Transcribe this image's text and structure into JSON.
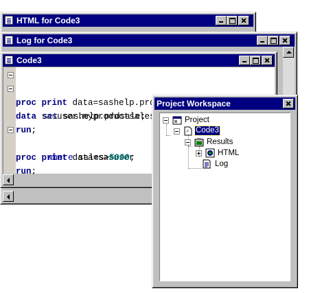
{
  "windows": {
    "html": {
      "title": "HTML for Code3"
    },
    "log": {
      "title": "Log for Code3"
    },
    "code": {
      "title": "Code3",
      "lines": [
        {
          "kw": "proc print",
          "rest": " data=sashelp.prdsale;"
        },
        {
          "kw": "data",
          "rest": " sasuser.myproductsales;"
        },
        {
          "kw2": "set",
          "rest": " sashelp.prdsale;"
        },
        {
          "kw": "run",
          "rest": ";"
        },
        {
          "kw": "proc print",
          "rest": " data=sasuser"
        },
        {
          "kw2": "where",
          "rest": " sales>",
          "num": "5000",
          "tail": ";"
        },
        {
          "kw": "run",
          "rest": ";"
        }
      ]
    },
    "workspace": {
      "title": "Project Workspace",
      "tree": {
        "project": "Project",
        "code": "Code3",
        "results": "Results",
        "html": "HTML",
        "log": "Log"
      }
    }
  },
  "icons": [
    "window-icon",
    "minimize-icon",
    "maximize-icon",
    "close-icon",
    "project-icon",
    "program-icon",
    "results-icon",
    "html-icon",
    "log-icon"
  ]
}
